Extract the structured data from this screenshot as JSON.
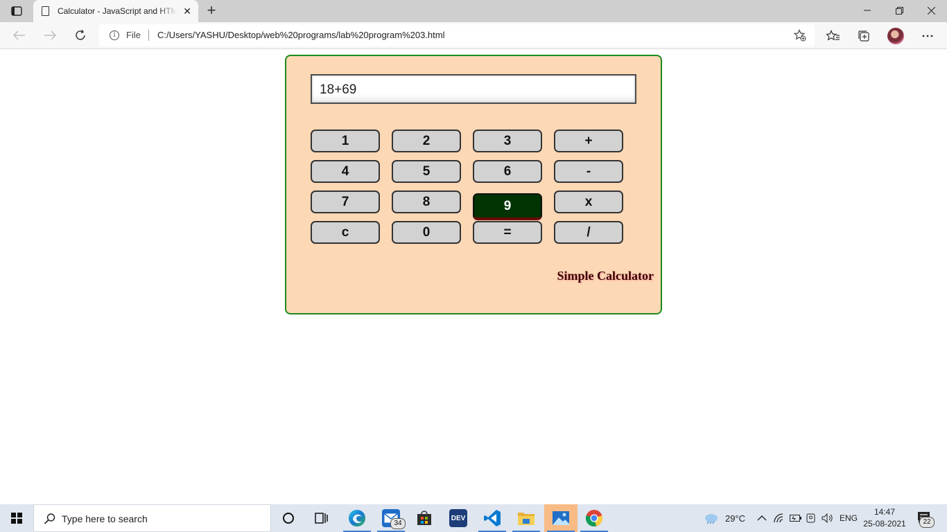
{
  "browser": {
    "tab_title": "Calculator - JavaScript and HTML",
    "tab_close": "✕",
    "new_tab": "+",
    "file_label": "File",
    "url": "C:/Users/YASHU/Desktop/web%20programs/lab%20program%203.html"
  },
  "calculator": {
    "display_value": "18+69",
    "keys": [
      [
        "1",
        "2",
        "3",
        "+"
      ],
      [
        "4",
        "5",
        "6",
        "-"
      ],
      [
        "7",
        "8",
        "9",
        "x"
      ],
      [
        "c",
        "0",
        "=",
        "/"
      ]
    ],
    "active_key": "9",
    "label": "Simple Calculator",
    "colors": {
      "panel": "#fdd8b5",
      "panel_border": "#1b8a1b",
      "key": "#d2d2d2",
      "active_key": "#023302",
      "label": "#3a0000"
    }
  },
  "taskbar": {
    "search_placeholder": "Type here to search",
    "mail_badge": "34",
    "dev_label": "DEV",
    "temperature": "29°C",
    "language": "ENG",
    "time": "14:47",
    "date": "25-08-2021",
    "notification_count": "22"
  },
  "icons": {
    "tab_actions": "tab-actions-icon",
    "page": "page-icon",
    "back": "back-arrow-icon",
    "forward": "forward-arrow-icon",
    "refresh": "refresh-icon",
    "info": "info-icon",
    "add_favorite": "add-favorite-icon",
    "favorites": "favorites-icon",
    "collections": "collections-icon",
    "more": "more-icon"
  }
}
